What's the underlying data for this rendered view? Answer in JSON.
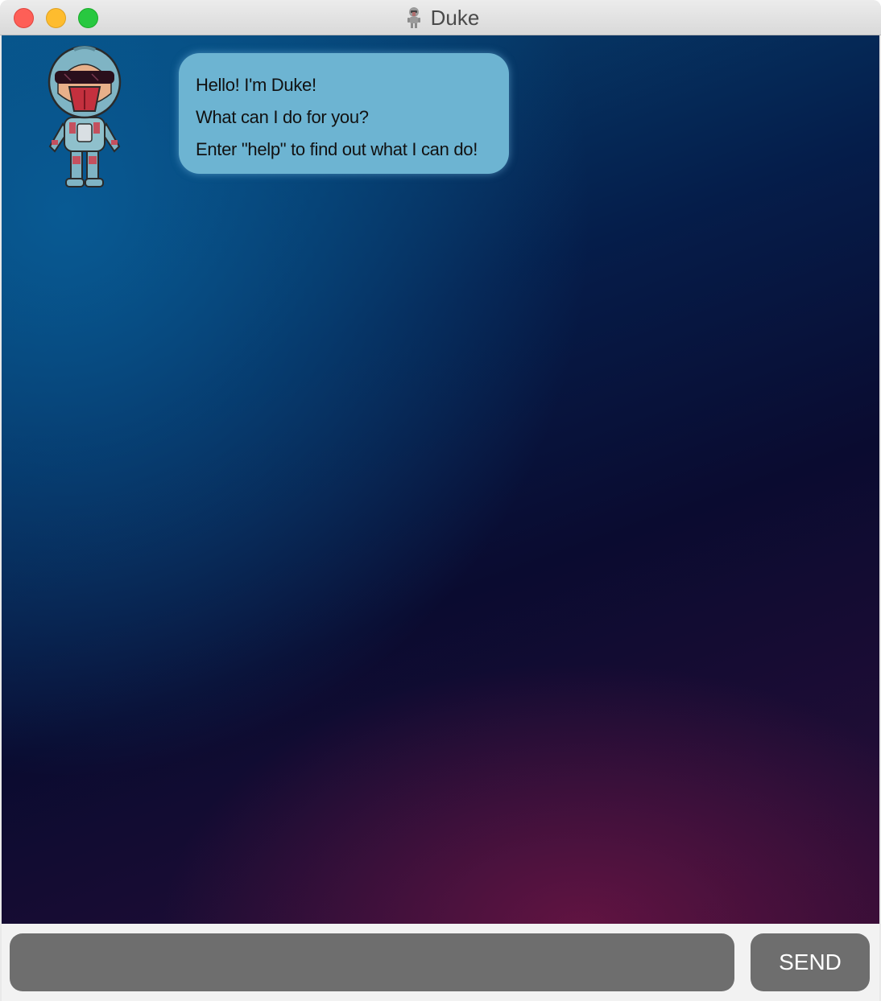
{
  "window": {
    "title": "Duke",
    "title_icon": "robot-icon"
  },
  "chat": {
    "messages": [
      {
        "sender": "duke",
        "avatar": "robot-avatar",
        "lines": [
          "Hello! I'm Duke!",
          "What can I do for you?",
          "Enter \"help\" to find out what I can do!"
        ]
      }
    ]
  },
  "input": {
    "value": "",
    "placeholder": ""
  },
  "send_button": {
    "label": "SEND"
  },
  "colors": {
    "bubble": "#6db4d2",
    "input_background": "#6e6e6e",
    "close": "#fe5f57",
    "minimize": "#febc2e",
    "maximize": "#28c840"
  }
}
